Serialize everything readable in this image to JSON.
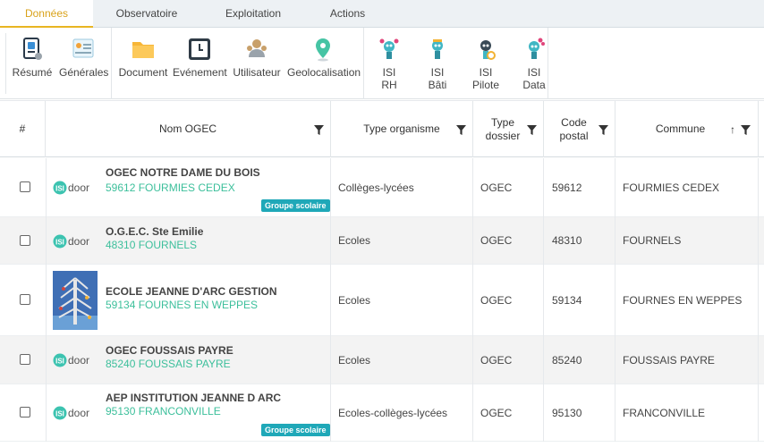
{
  "tabs": [
    {
      "label": "Données",
      "active": true
    },
    {
      "label": "Observatoire",
      "active": false
    },
    {
      "label": "Exploitation",
      "active": false
    },
    {
      "label": "Actions",
      "active": false
    }
  ],
  "toolbar": {
    "resume": "Résumé",
    "generales": "Générales",
    "document": "Document",
    "evenement": "Evénement",
    "utilisateur": "Utilisateur",
    "geolocalisation": "Geolocalisation",
    "isi_rh": [
      "ISI",
      "RH"
    ],
    "isi_bati": [
      "ISI",
      "Bâti"
    ],
    "isi_pilote": [
      "ISI",
      "Pilote"
    ],
    "isi_data": [
      "ISI",
      "Data"
    ]
  },
  "table": {
    "headers": {
      "num": "#",
      "nom": "Nom OGEC",
      "type_org": "Type organisme",
      "type_dossier": [
        "Type",
        "dossier"
      ],
      "code_postal": [
        "Code",
        "postal"
      ],
      "commune": "Commune",
      "sort_indicator": "↑"
    },
    "logo_text": "ISIdoor",
    "rows": [
      {
        "name": "OGEC NOTRE DAME DU BOIS",
        "address": "59612 FOURMIES CEDEX",
        "badge": "Groupe scolaire",
        "type_org": "Collèges-lycées",
        "dossier": "OGEC",
        "cp": "59612",
        "commune": "FOURMIES CEDEX"
      },
      {
        "name": "O.G.E.C. Ste Emilie",
        "address": "48310 FOURNELS",
        "badge": "",
        "type_org": "Ecoles",
        "dossier": "OGEC",
        "cp": "48310",
        "commune": "FOURNELS"
      },
      {
        "name": "ECOLE JEANNE D'ARC GESTION",
        "address": "59134 FOURNES EN WEPPES",
        "badge": "",
        "type_org": "Ecoles",
        "dossier": "OGEC",
        "cp": "59134",
        "commune": "FOURNES EN WEPPES"
      },
      {
        "name": "OGEC FOUSSAIS PAYRE",
        "address": "85240 FOUSSAIS PAYRE",
        "badge": "",
        "type_org": "Ecoles",
        "dossier": "OGEC",
        "cp": "85240",
        "commune": "FOUSSAIS PAYRE"
      },
      {
        "name": "AEP INSTITUTION JEANNE D ARC",
        "address": "95130 FRANCONVILLE",
        "badge": "Groupe scolaire",
        "type_org": "Ecoles-collèges-lycées",
        "dossier": "OGEC",
        "cp": "95130",
        "commune": "FRANCONVILLE"
      }
    ]
  },
  "colors": {
    "active_tab": "#d9a21a",
    "link": "#3cbf9b",
    "badge": "#1fa8b8",
    "alt_row": "#f3f3f3"
  }
}
